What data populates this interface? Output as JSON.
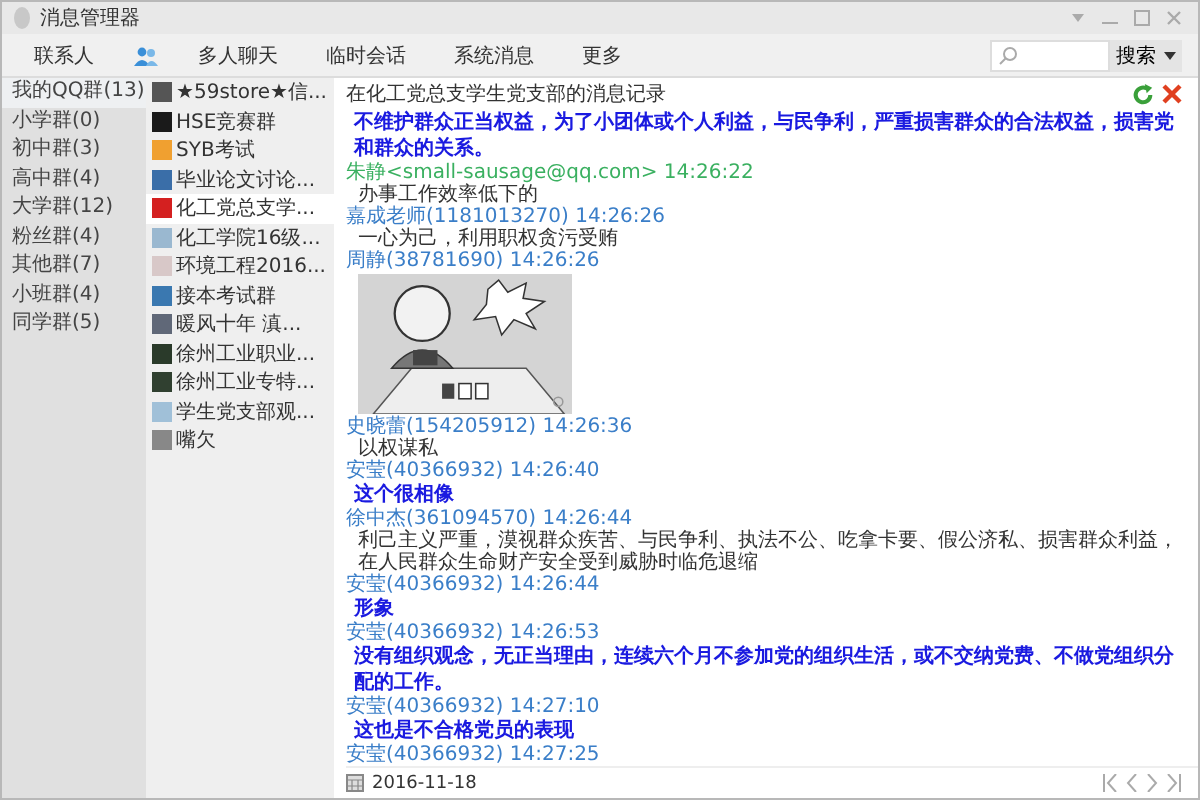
{
  "window": {
    "title": "消息管理器"
  },
  "tabs": [
    {
      "kind": "text",
      "label": "联系人",
      "selected": false
    },
    {
      "kind": "icon",
      "selected": true
    },
    {
      "kind": "text",
      "label": "多人聊天",
      "selected": false
    },
    {
      "kind": "text",
      "label": "临时会话",
      "selected": false
    },
    {
      "kind": "text",
      "label": "系统消息",
      "selected": false
    },
    {
      "kind": "text",
      "label": "更多",
      "selected": false
    }
  ],
  "search": {
    "button": "搜索"
  },
  "categories": [
    {
      "label": "我的QQ群(13)",
      "selected": true
    },
    {
      "label": "小学群(0)",
      "selected": false
    },
    {
      "label": "初中群(3)",
      "selected": false
    },
    {
      "label": "高中群(4)",
      "selected": false
    },
    {
      "label": "大学群(12)",
      "selected": false
    },
    {
      "label": "粉丝群(4)",
      "selected": false
    },
    {
      "label": "其他群(7)",
      "selected": false
    },
    {
      "label": "小班群(4)",
      "selected": false
    },
    {
      "label": "同学群(5)",
      "selected": false
    }
  ],
  "groups": [
    {
      "label": "★59store★信...",
      "color": "#555555",
      "selected": false
    },
    {
      "label": "HSE竞赛群",
      "color": "#1a1a1a",
      "selected": false
    },
    {
      "label": "SYB考试",
      "color": "#f0a030",
      "selected": false
    },
    {
      "label": "毕业论文讨论...",
      "color": "#3a6ea8",
      "selected": false
    },
    {
      "label": "化工党总支学...",
      "color": "#d42020",
      "selected": true
    },
    {
      "label": "化工学院16级...",
      "color": "#9ab8d0",
      "selected": false
    },
    {
      "label": "环境工程2016...",
      "color": "#d8c8c8",
      "selected": false
    },
    {
      "label": "接本考试群",
      "color": "#3a78b0",
      "selected": false
    },
    {
      "label": "暖风十年 滇...",
      "color": "#606878",
      "selected": false
    },
    {
      "label": "徐州工业职业...",
      "color": "#2a3a2a",
      "selected": false
    },
    {
      "label": "徐州工业专特...",
      "color": "#304030",
      "selected": false
    },
    {
      "label": "学生党支部观...",
      "color": "#a0c0d8",
      "selected": false
    },
    {
      "label": "嘴欠",
      "color": "#888888",
      "selected": false
    }
  ],
  "history": {
    "title": "在化工党总支学生党支部的消息记录",
    "messages": [
      {
        "kind": "big",
        "text": "不维护群众正当权益，为了小团体或个人利益，与民争利，严重损害群众的合法权益，损害党和群众的关系。"
      },
      {
        "sender": "朱静<small-sausage@qq.com> 14:26:22",
        "self": true,
        "kind": "text",
        "text": "办事工作效率低下的"
      },
      {
        "sender": "嘉成老师(1181013270) 14:26:26",
        "self": false,
        "kind": "text",
        "text": "一心为己，利用职权贪污受贿"
      },
      {
        "sender": "周静(38781690) 14:26:26",
        "self": false
      },
      {
        "sender": "史晓蕾(154205912) 14:26:36",
        "self": false,
        "kind": "text",
        "text": "以权谋私"
      },
      {
        "sender": "安莹(40366932) 14:26:40",
        "self": false,
        "kind": "big",
        "text": "这个很相像"
      },
      {
        "sender": "徐中杰(361094570) 14:26:44",
        "self": false,
        "kind": "text",
        "text": "利己主义严重，漠视群众疾苦、与民争利、执法不公、吃拿卡要、假公济私、损害群众利益，在人民群众生命财产安全受到威胁时临危退缩"
      },
      {
        "sender": "安莹(40366932) 14:26:44",
        "self": false,
        "kind": "big",
        "text": "形象"
      },
      {
        "sender": "安莹(40366932) 14:26:53",
        "self": false,
        "kind": "big",
        "text": "没有组织观念，无正当理由，连续六个月不参加党的组织生活，或不交纳党费、不做党组织分配的工作。"
      },
      {
        "sender": "安莹(40366932) 14:27:10",
        "self": false,
        "kind": "big",
        "text": "这也是不合格党员的表现"
      },
      {
        "sender": "安莹(40366932) 14:27:25",
        "self": false
      }
    ]
  },
  "footer": {
    "date": "2016-11-18"
  }
}
